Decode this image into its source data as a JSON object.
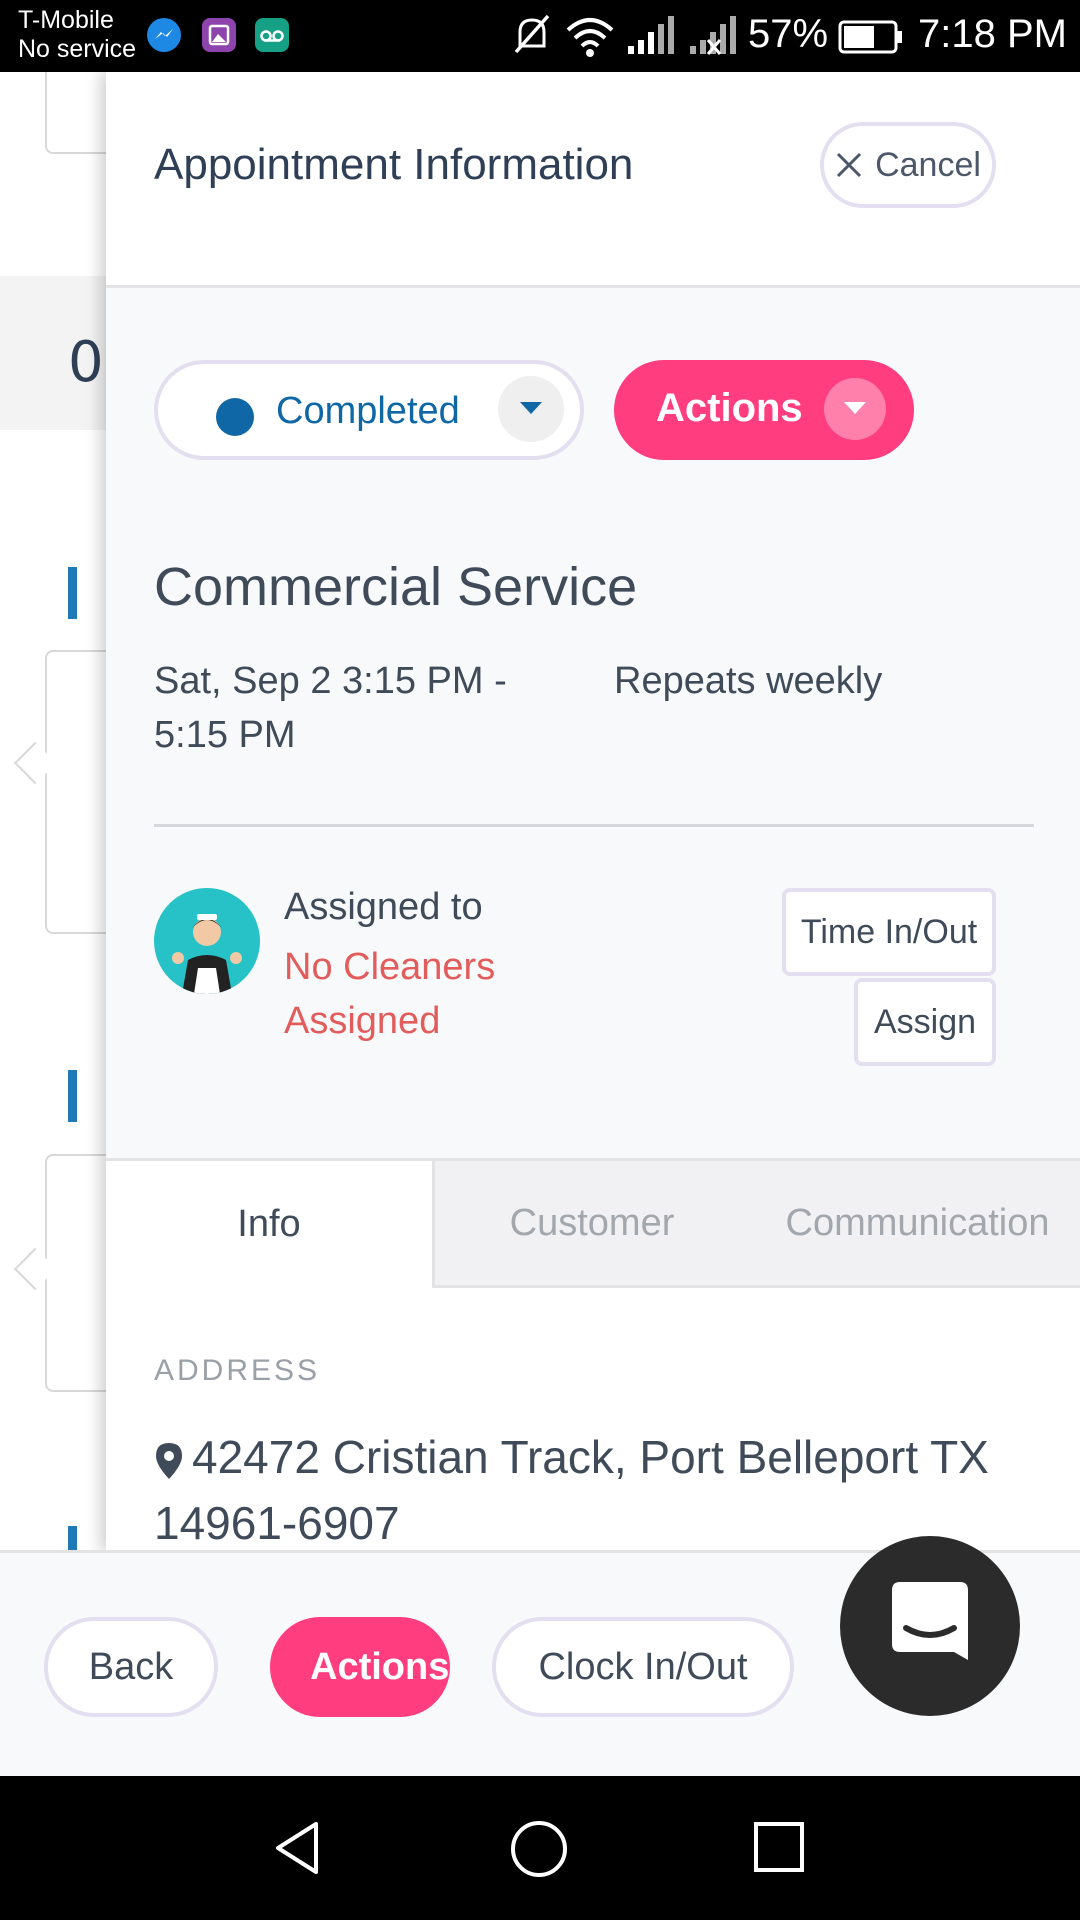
{
  "status_bar": {
    "carrier": "T-Mobile",
    "service": "No service",
    "battery": "57%",
    "time": "7:18 PM",
    "icons": [
      "messenger-icon",
      "gallery-icon",
      "voicemail-icon",
      "mute-icon",
      "wifi-icon",
      "signal-icon",
      "signal-off-icon",
      "battery-icon"
    ]
  },
  "background": {
    "number": "0"
  },
  "panel": {
    "title": "Appointment Information",
    "cancel_label": "Cancel",
    "status_value": "Completed",
    "actions_label": "Actions",
    "service_name": "Commercial Service",
    "time_range": "Sat, Sep 2 3:15 PM - 5:15 PM",
    "repeat": "Repeats weekly",
    "assigned_label": "Assigned to",
    "assigned_value": "No Cleaners Assigned",
    "time_in_out_label": "Time In/Out",
    "assign_label": "Assign",
    "tabs": [
      {
        "label": "Info"
      },
      {
        "label": "Customer"
      },
      {
        "label": "Communication"
      }
    ],
    "address_label": "ADDRESS",
    "address": "42472 Cristian Track, Port Belleport TX 14961-6907"
  },
  "bottom_bar": {
    "back_label": "Back",
    "actions_label": "Actions",
    "clock_label": "Clock In/Out"
  },
  "colors": {
    "accent_pink": "#ff3d7f",
    "status_blue": "#1067a5",
    "warning_red": "#e25c5c",
    "text_dark": "#404b5a"
  }
}
